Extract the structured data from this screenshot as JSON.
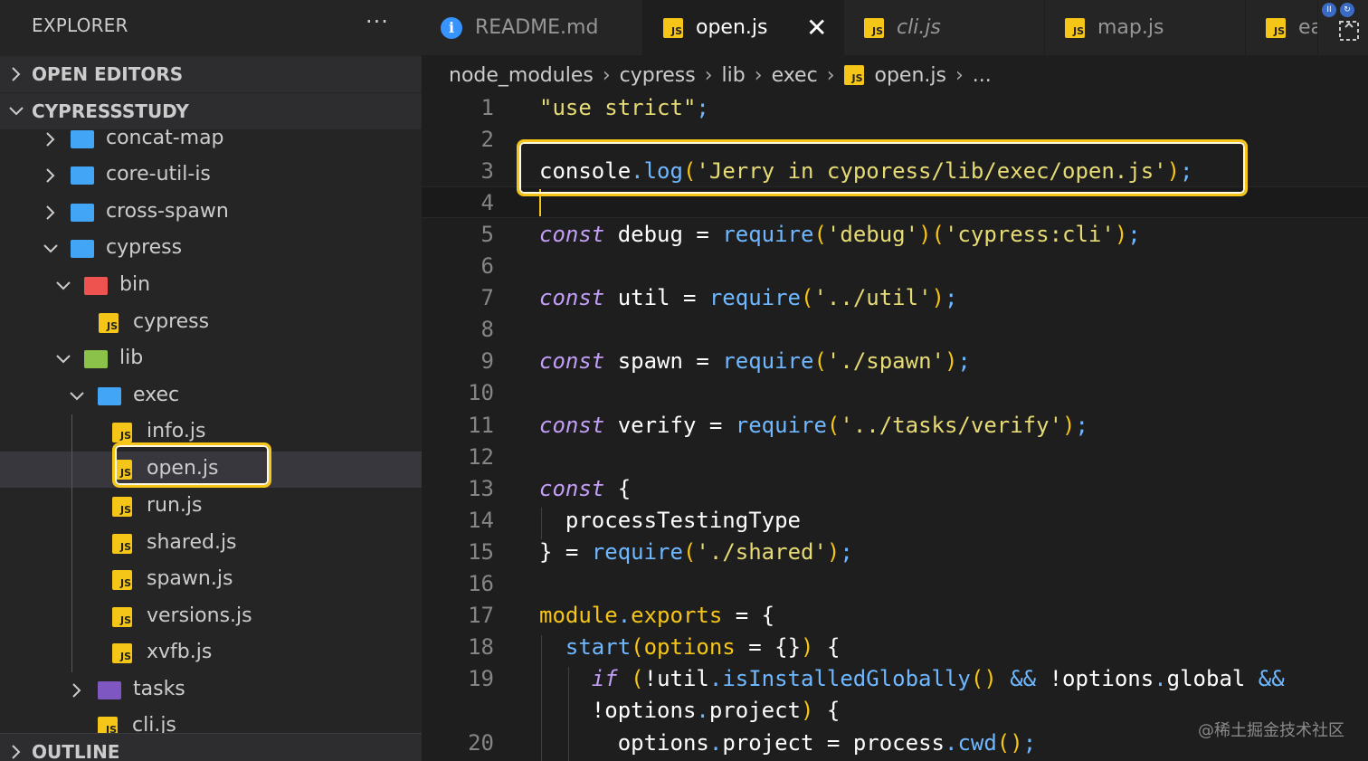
{
  "explorer": {
    "title": "EXPLORER",
    "more": "···",
    "sections": {
      "open_editors": "OPEN EDITORS",
      "project": "CYPRESSSTUDY",
      "outline": "OUTLINE"
    },
    "tree": [
      {
        "label": "concat-map",
        "kind": "folder",
        "color": "blue",
        "expanded": false
      },
      {
        "label": "core-util-is",
        "kind": "folder",
        "color": "blue",
        "expanded": false
      },
      {
        "label": "cross-spawn",
        "kind": "folder",
        "color": "blue",
        "expanded": false
      },
      {
        "label": "cypress",
        "kind": "folder",
        "color": "blue",
        "expanded": true
      },
      {
        "label": "bin",
        "kind": "folder",
        "color": "red",
        "expanded": true
      },
      {
        "label": "cypress",
        "kind": "js"
      },
      {
        "label": "lib",
        "kind": "folder",
        "color": "green",
        "expanded": true
      },
      {
        "label": "exec",
        "kind": "folder",
        "color": "blue",
        "expanded": true
      },
      {
        "label": "info.js",
        "kind": "js"
      },
      {
        "label": "open.js",
        "kind": "js",
        "selected": true
      },
      {
        "label": "run.js",
        "kind": "js"
      },
      {
        "label": "shared.js",
        "kind": "js"
      },
      {
        "label": "spawn.js",
        "kind": "js"
      },
      {
        "label": "versions.js",
        "kind": "js"
      },
      {
        "label": "xvfb.js",
        "kind": "js"
      },
      {
        "label": "tasks",
        "kind": "folder",
        "color": "purple",
        "expanded": false
      },
      {
        "label": "cli.js",
        "kind": "js"
      }
    ]
  },
  "tabs": [
    {
      "label": "README.md",
      "icon": "info-icon"
    },
    {
      "label": "open.js",
      "icon": "js-icon",
      "active": true,
      "close": "✕"
    },
    {
      "label": "cli.js",
      "icon": "js-icon",
      "italic": true
    },
    {
      "label": "map.js",
      "icon": "js-icon"
    },
    {
      "label": "ea",
      "icon": "js-icon"
    }
  ],
  "breadcrumb": [
    "node_modules",
    "cypress",
    "lib",
    "exec",
    "open.js",
    "..."
  ],
  "code": {
    "lines": [
      {
        "n": "1",
        "text": "\"use strict\";"
      },
      {
        "n": "2",
        "text": ""
      },
      {
        "n": "3",
        "text": "console.log('Jerry in cyporess/lib/exec/open.js');"
      },
      {
        "n": "4",
        "text": ""
      },
      {
        "n": "5",
        "text": "const debug = require('debug')('cypress:cli');"
      },
      {
        "n": "6",
        "text": ""
      },
      {
        "n": "7",
        "text": "const util = require('../util');"
      },
      {
        "n": "8",
        "text": ""
      },
      {
        "n": "9",
        "text": "const spawn = require('./spawn');"
      },
      {
        "n": "10",
        "text": ""
      },
      {
        "n": "11",
        "text": "const verify = require('../tasks/verify');"
      },
      {
        "n": "12",
        "text": ""
      },
      {
        "n": "13",
        "text": "const {"
      },
      {
        "n": "14",
        "text": "  processTestingType"
      },
      {
        "n": "15",
        "text": "} = require('./shared');"
      },
      {
        "n": "16",
        "text": ""
      },
      {
        "n": "17",
        "text": "module.exports = {"
      },
      {
        "n": "18",
        "text": "  start(options = {}) {"
      },
      {
        "n": "19",
        "text": "    if (!util.isInstalledGlobally() && !options.global &&"
      },
      {
        "n": "",
        "text": "    !options.project) {"
      },
      {
        "n": "20",
        "text": "      options.project = process.cwd();"
      }
    ]
  },
  "watermark": "@稀土掘金技术社区",
  "colors": {
    "accent_highlight": "#f5c518",
    "string": "#e6db74",
    "keyword": "#c39ef7",
    "function": "#6fb8ff"
  }
}
